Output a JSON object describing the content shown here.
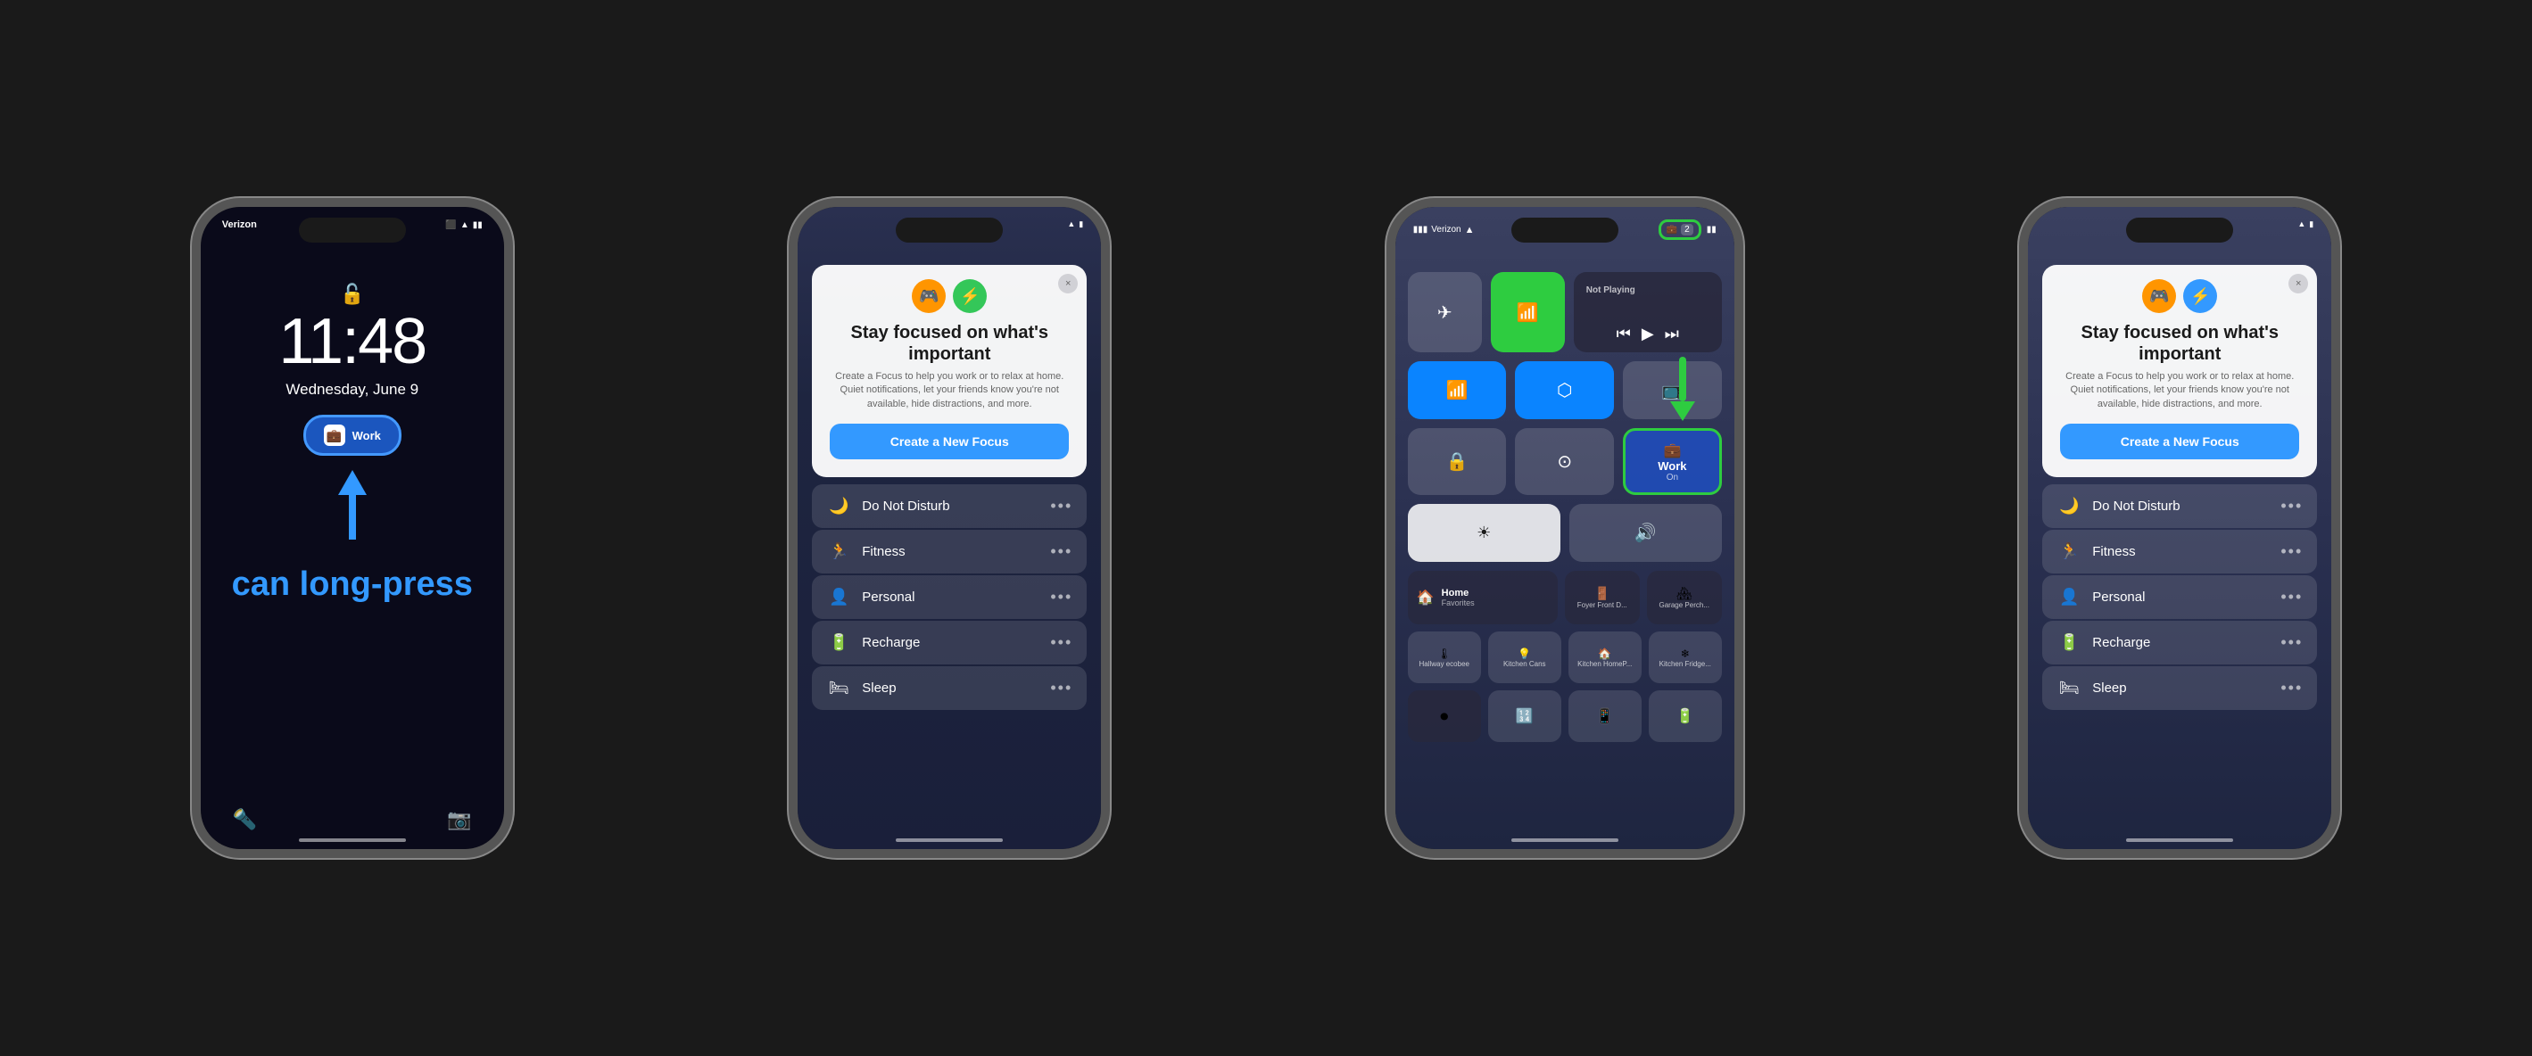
{
  "page": {
    "bg_color": "#1a1a1a"
  },
  "phone1": {
    "carrier": "Verizon",
    "time": "11:48",
    "date": "Wednesday, June 9",
    "can_long_press": "can long-press",
    "focus_badge_icon": "💼",
    "bottom_icons": [
      "🔦",
      "📷"
    ]
  },
  "phone2": {
    "header_icons": [
      "🎮",
      "⚡"
    ],
    "title": "Stay focused on what's important",
    "subtitle": "Create a Focus to help you work or to relax at home. Quiet notifications, let your friends know you're not available, hide distractions, and more.",
    "create_btn": "Create a New Focus",
    "close_icon": "×",
    "menu_items": [
      {
        "icon": "🌙",
        "label": "Do Not Disturb"
      },
      {
        "icon": "🏃",
        "label": "Fitness"
      },
      {
        "icon": "👤",
        "label": "Personal"
      },
      {
        "icon": "🔋",
        "label": "Recharge"
      },
      {
        "icon": "🛏",
        "label": "Sleep"
      }
    ]
  },
  "phone3": {
    "carrier": "Verizon",
    "not_playing": "Not Playing",
    "work_label": "Work",
    "work_sub": "On",
    "home_label": "Home",
    "home_sub": "Favorites",
    "tiles": [
      "airplane",
      "cellular",
      "wifi",
      "bluetooth",
      "lock-rotation",
      "screen-record",
      "focus-work",
      "brightness",
      "volume",
      "home",
      "front-door",
      "garage-porch",
      "hallway",
      "kitchen-cans",
      "kitchen-home",
      "kitchen-fridge",
      "record",
      "calculator",
      "remote",
      "battery"
    ]
  },
  "phone4": {
    "header_icons": [
      "🎮",
      "⚡"
    ],
    "title": "Stay focused on what's important",
    "subtitle": "Create a Focus to help you work or to relax at home. Quiet notifications, let your friends know you're not available, hide distractions, and more.",
    "create_btn": "Create a New Focus",
    "close_icon": "×",
    "menu_items": [
      {
        "icon": "🌙",
        "label": "Do Not Disturb"
      },
      {
        "icon": "🏃",
        "label": "Fitness"
      },
      {
        "icon": "👤",
        "label": "Personal"
      },
      {
        "icon": "🔋",
        "label": "Recharge"
      },
      {
        "icon": "🛏",
        "label": "Sleep"
      }
    ]
  }
}
